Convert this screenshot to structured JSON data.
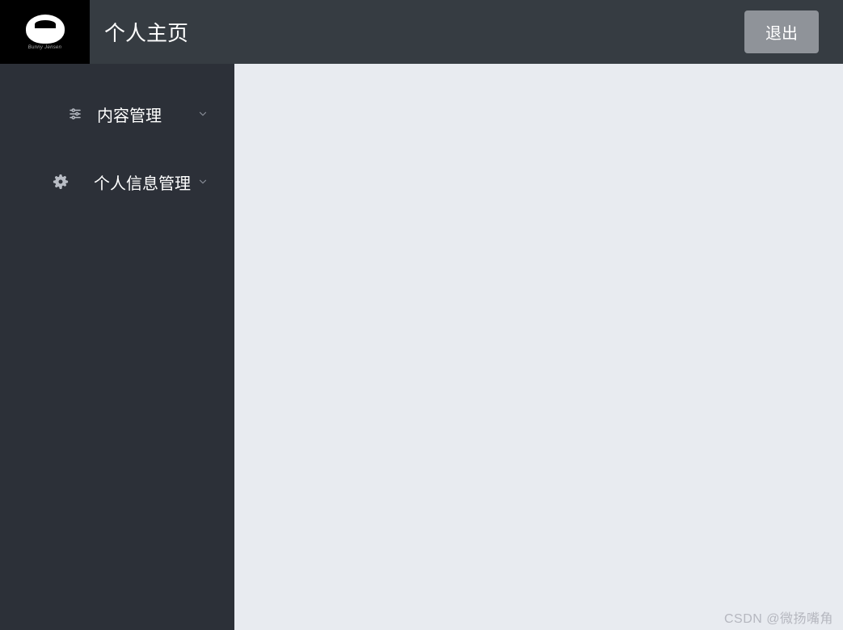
{
  "header": {
    "title": "个人主页",
    "logout_label": "退出",
    "logo_subtitle": "Bunny Jensen"
  },
  "sidebar": {
    "items": [
      {
        "label": "内容管理",
        "icon": "sliders"
      },
      {
        "label": "个人信息管理",
        "icon": "gear"
      }
    ]
  },
  "watermark": "CSDN @微扬嘴角"
}
